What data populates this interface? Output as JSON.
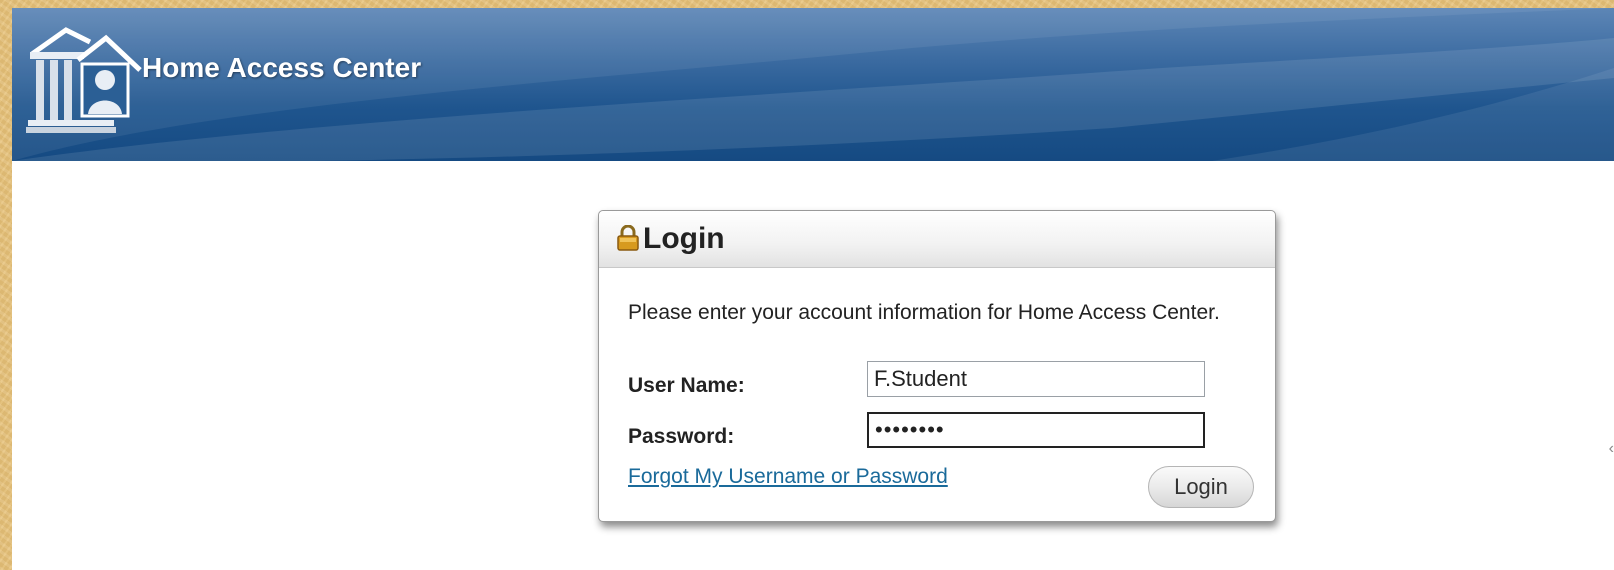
{
  "header": {
    "title": "Home Access Center",
    "logo_icon": "building-person-icon",
    "colors": {
      "header_dark": "#154a82",
      "header_light": "#5d86b6"
    }
  },
  "login_panel": {
    "title": "Login",
    "title_icon": "lock-icon",
    "instructions": "Please enter your account information for Home Access Center.",
    "username_label": "User Name:",
    "username_value": "F.Student",
    "password_label": "Password:",
    "password_value": "••••••••",
    "forgot_link": "Forgot My Username or Password",
    "login_button": "Login",
    "colors": {
      "link": "#1a6a9a"
    }
  }
}
